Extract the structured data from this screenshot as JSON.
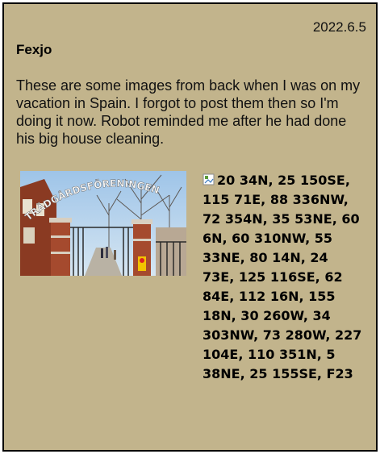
{
  "post": {
    "date": "2022.6.5",
    "author": "Fexjo",
    "text": "These are some images from back when I was on my vacation in Spain. I forgot to post them then so I'm doing it now. Robot reminded me after he had done his big house cleaning.",
    "photo": {
      "sign_text": "TRÄDGÅRDSFÖRENINGEN"
    },
    "broken_image_alt": "20 34N, 25 150SE, 115 71E, 88 336NW, 72 354N, 35 53NE, 60 6N, 60 310NW, 55 33NE, 80 14N, 24 73E, 125 116SE, 62 84E, 112 16N, 155 18N, 30 260W, 34 303NW, 73 280W, 227 104E, 110 351N, 5 38NE, 25 155SE, F23"
  },
  "colors": {
    "background": "#c2b48c",
    "border": "#000000"
  },
  "icons": {
    "broken_image": "broken-image-icon"
  }
}
